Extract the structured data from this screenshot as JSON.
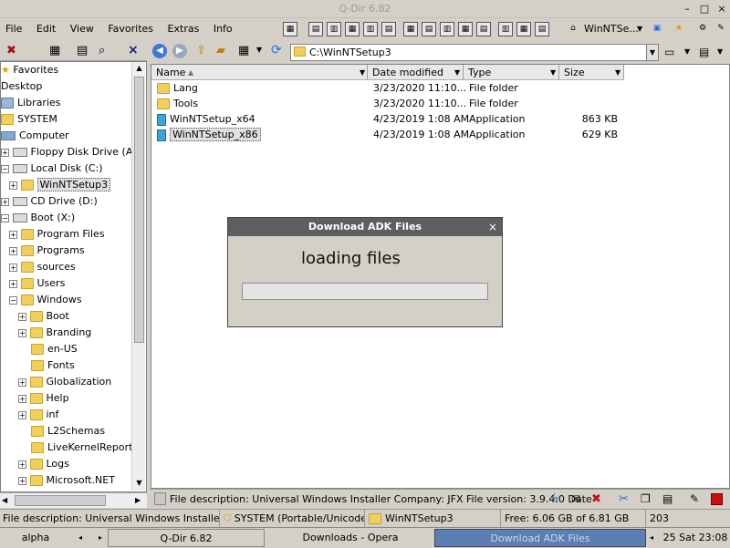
{
  "window": {
    "title": "Q-Dir 6.82"
  },
  "menu": [
    "File",
    "Edit",
    "View",
    "Favorites",
    "Extras",
    "Info"
  ],
  "toolbar": {
    "dropdown_label": "WinNTSe..."
  },
  "tree": {
    "items": [
      {
        "label": "Favorites"
      },
      {
        "label": "Desktop"
      },
      {
        "label": "Libraries"
      },
      {
        "label": "SYSTEM"
      },
      {
        "label": "Computer"
      },
      {
        "label": "Floppy Disk Drive (A:)"
      },
      {
        "label": "Local Disk (C:)"
      },
      {
        "label": "WinNTSetup3"
      },
      {
        "label": "CD Drive (D:)"
      },
      {
        "label": "Boot (X:)"
      },
      {
        "label": "Program Files"
      },
      {
        "label": "Programs"
      },
      {
        "label": "sources"
      },
      {
        "label": "Users"
      },
      {
        "label": "Windows"
      },
      {
        "label": "Boot"
      },
      {
        "label": "Branding"
      },
      {
        "label": "en-US"
      },
      {
        "label": "Fonts"
      },
      {
        "label": "Globalization"
      },
      {
        "label": "Help"
      },
      {
        "label": "inf"
      },
      {
        "label": "L2Schemas"
      },
      {
        "label": "LiveKernelReports"
      },
      {
        "label": "Logs"
      },
      {
        "label": "Microsoft.NET"
      }
    ]
  },
  "address": {
    "path": "C:\\WinNTSetup3"
  },
  "list": {
    "columns": [
      "Name",
      "Date modified",
      "Type",
      "Size"
    ],
    "rows": [
      {
        "name": "Lang",
        "date": "3/23/2020 11:10...",
        "type": "File folder",
        "size": ""
      },
      {
        "name": "Tools",
        "date": "3/23/2020 11:10...",
        "type": "File folder",
        "size": ""
      },
      {
        "name": "WinNTSetup_x64",
        "date": "4/23/2019 1:08 AM",
        "type": "Application",
        "size": "863 KB"
      },
      {
        "name": "WinNTSetup_x86",
        "date": "4/23/2019 1:08 AM",
        "type": "Application",
        "size": "629 KB"
      }
    ]
  },
  "dialog": {
    "title": "Download ADK Files",
    "close": "×",
    "message": "loading files",
    "progress": 0
  },
  "infobar": {
    "text": "File description: Universal Windows Installer Company: JFX File version: 3.9.4.0 Date"
  },
  "statusbar": {
    "description": "File description: Universal Windows Installer Comp",
    "mode": "SYSTEM (Portable/Unicode)",
    "folder": "WinNTSetup3",
    "free": "Free: 6.06 GB of 6.81 GB",
    "count": "203"
  },
  "taskbar": {
    "start": "alpha",
    "tasks": [
      "Q-Dir 6.82",
      "Downloads - Opera",
      "Download ADK Files"
    ],
    "clock": "25 Sat 23:08"
  }
}
